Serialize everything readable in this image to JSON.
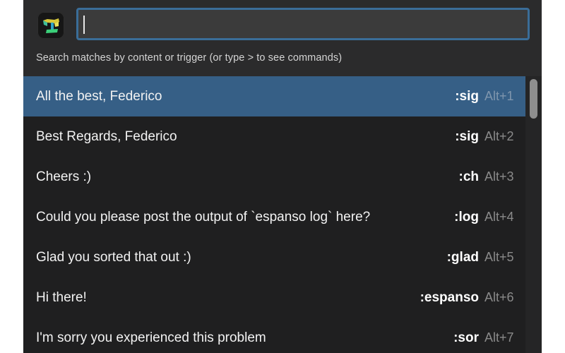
{
  "search": {
    "value": "",
    "hint": "Search matches by content or trigger (or type > to see commands)"
  },
  "app_icon": {
    "name": "espanso-logo-icon"
  },
  "colors": {
    "selected_row": "#365f86",
    "search_border": "#3a6d98",
    "background": "#1f1f20"
  },
  "matches": [
    {
      "label": "All the best, Federico",
      "trigger": ":sig",
      "shortcut": "Alt+1",
      "selected": true
    },
    {
      "label": "Best Regards, Federico",
      "trigger": ":sig",
      "shortcut": "Alt+2"
    },
    {
      "label": "Cheers :)",
      "trigger": ":ch",
      "shortcut": "Alt+3"
    },
    {
      "label": "Could you please post the output of `espanso log` here?",
      "trigger": ":log",
      "shortcut": "Alt+4"
    },
    {
      "label": "Glad you sorted that out :)",
      "trigger": ":glad",
      "shortcut": "Alt+5"
    },
    {
      "label": "Hi there!",
      "trigger": ":espanso",
      "shortcut": "Alt+6"
    },
    {
      "label": "I'm sorry you experienced this problem",
      "trigger": ":sor",
      "shortcut": "Alt+7"
    }
  ]
}
